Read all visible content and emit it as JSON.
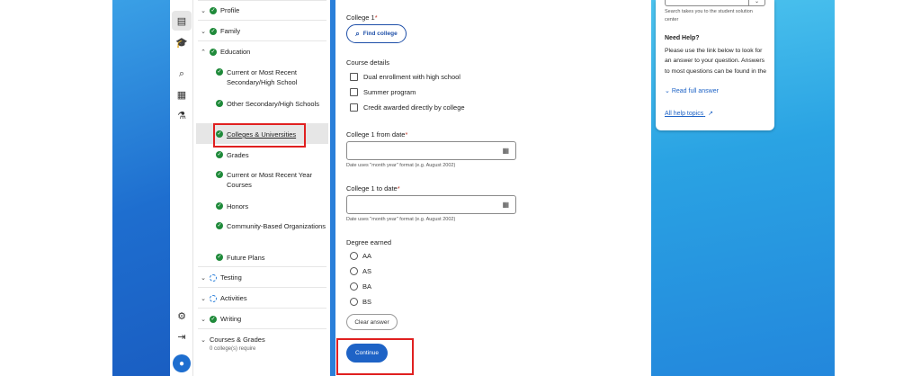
{
  "nav": {
    "items": [
      {
        "label": "Profile",
        "status": "complete"
      },
      {
        "label": "Family",
        "status": "complete"
      },
      {
        "label": "Education",
        "status": "complete",
        "expanded": true
      },
      {
        "label": "Testing",
        "status": "in-progress"
      },
      {
        "label": "Activities",
        "status": "in-progress"
      },
      {
        "label": "Writing",
        "status": "complete"
      },
      {
        "label": "Courses & Grades",
        "sublabel": "0 college(s) require"
      }
    ],
    "education_sub": [
      "Current or Most Recent Secondary/High School",
      "Other Secondary/High Schools",
      "Colleges & Universities",
      "Grades",
      "Current or Most Recent Year Courses",
      "Honors",
      "Community-Based Organizations",
      "Future Plans"
    ]
  },
  "form": {
    "college_label": "College 1",
    "required_mark": "*",
    "find_college": "Find college",
    "course_details_label": "Course details",
    "checkboxes": [
      "Dual enrollment with high school",
      "Summer program",
      "Credit awarded directly by college"
    ],
    "from_date_label": "College 1 from date",
    "to_date_label": "College 1 to date",
    "date_hint": "Date uses \"month year\" format (e.g. August 2002)",
    "degree_label": "Degree earned",
    "degrees": [
      "AA",
      "AS",
      "BA",
      "BS"
    ],
    "clear_answer": "Clear answer",
    "continue": "Continue"
  },
  "help": {
    "search_hint": "Search takes you to the student solution center",
    "title": "Need Help?",
    "body": "Please use the link below to look for an answer to your question. Answers to most questions can be found in the knowledgebas...",
    "read_full": "Read full answer",
    "all_topics": "All help topics"
  },
  "colors": {
    "brand_blue": "#1e63c6",
    "complete_green": "#1f8a3a",
    "highlight_red": "#e02020"
  }
}
